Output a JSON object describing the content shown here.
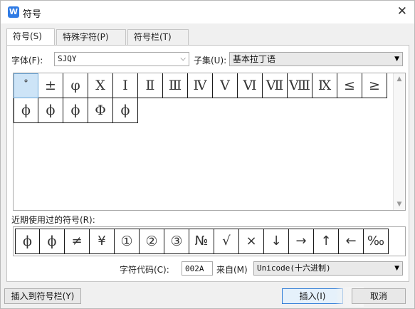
{
  "window": {
    "title": "符号",
    "app_icon_letter": "W"
  },
  "tabs": [
    {
      "label": "符号(S)",
      "active": true
    },
    {
      "label": "特殊字符(P)",
      "active": false
    },
    {
      "label": "符号栏(T)",
      "active": false
    }
  ],
  "font": {
    "label": "字体(F):",
    "value": "SJQY"
  },
  "subset": {
    "label": "子集(U):",
    "value": "基本拉丁语"
  },
  "symbols": [
    "°",
    "±",
    "φ",
    "Ⅹ",
    "Ⅰ",
    "Ⅱ",
    "Ⅲ",
    "Ⅳ",
    "Ⅴ",
    "Ⅵ",
    "Ⅶ",
    "Ⅷ",
    "Ⅸ",
    "≤",
    "≥",
    "ϕ",
    "ϕ",
    "ϕ",
    "Φ",
    "ϕ"
  ],
  "recent": {
    "label": "近期使用过的符号(R):",
    "items": [
      "ϕ",
      "ϕ",
      "≠",
      "¥",
      "①",
      "②",
      "③",
      "№",
      "√",
      "×",
      "↓",
      "→",
      "↑",
      "←",
      "‰"
    ]
  },
  "char_code": {
    "label": "字符代码(C):",
    "value": "002A"
  },
  "from": {
    "label": "来自(M)",
    "value": "Unicode(十六进制)"
  },
  "buttons": {
    "insert_to_bar": "插入到符号栏(Y)",
    "insert": "插入(I)",
    "cancel": "取消"
  },
  "icons": {
    "close": "close-icon",
    "dropdown": "chevron-down-icon",
    "scroll_up": "scroll-up-icon",
    "scroll_down": "scroll-down-icon"
  },
  "colors": {
    "accent": "#2f7be5",
    "selection": "#cde4f7"
  }
}
